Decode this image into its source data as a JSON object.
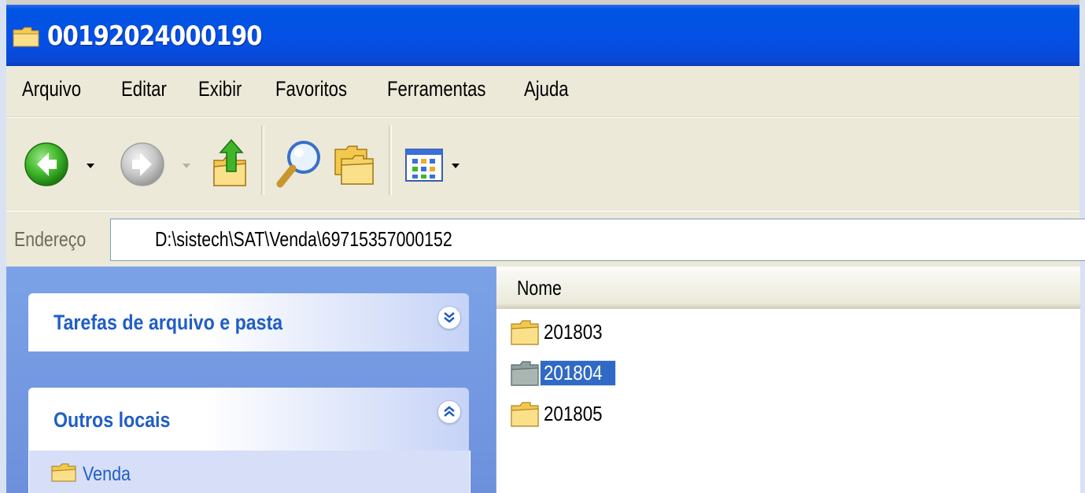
{
  "window": {
    "title": "00192024000190"
  },
  "menu": {
    "items": [
      {
        "label": "Arquivo"
      },
      {
        "label": "Editar"
      },
      {
        "label": "Exibir"
      },
      {
        "label": "Favoritos"
      },
      {
        "label": "Ferramentas"
      },
      {
        "label": "Ajuda"
      }
    ]
  },
  "toolbar": {
    "buttons": [
      {
        "icon": "back-arrow-icon"
      },
      {
        "icon": "forward-arrow-icon"
      },
      {
        "icon": "folder-up-icon"
      },
      {
        "icon": "search-magnifier-icon"
      },
      {
        "icon": "folders-icon"
      },
      {
        "icon": "views-icon"
      }
    ]
  },
  "address": {
    "label": "Endereço",
    "value": "D:\\sistech\\SAT\\Venda\\69715357000152"
  },
  "taskpane": {
    "file_tasks": {
      "title": "Tarefas de arquivo e pasta"
    },
    "other_places": {
      "title": "Outros locais",
      "links": [
        {
          "label": "Venda"
        }
      ]
    }
  },
  "filelist": {
    "column_name": "Nome",
    "items": [
      {
        "name": "201803",
        "selected": false
      },
      {
        "name": "201804",
        "selected": true
      },
      {
        "name": "201805",
        "selected": false
      }
    ]
  },
  "colors": {
    "titlebar": "#0054e3",
    "selection": "#316ac5",
    "taskpane_link": "#215dc6"
  }
}
